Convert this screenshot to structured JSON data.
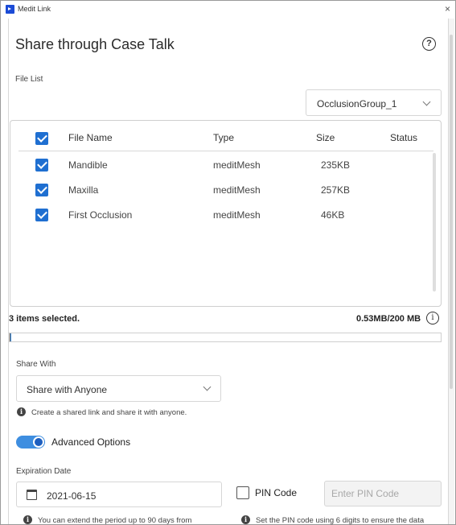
{
  "window": {
    "title": "Medit Link",
    "close_glyph": "×"
  },
  "page": {
    "title": "Share through Case Talk",
    "help_glyph": "?"
  },
  "file_list": {
    "label": "File List",
    "group_select": "OcclusionGroup_1",
    "columns": [
      "File Name",
      "Type",
      "Size",
      "Status"
    ],
    "rows": [
      {
        "name": "Mandible",
        "type": "meditMesh",
        "size": "235KB",
        "status": "",
        "checked": true
      },
      {
        "name": "Maxilla",
        "type": "meditMesh",
        "size": "257KB",
        "status": "",
        "checked": true
      },
      {
        "name": "First Occlusion",
        "type": "meditMesh",
        "size": "46KB",
        "status": "",
        "checked": true
      }
    ],
    "all_checked": true
  },
  "summary": {
    "selected_text": "3 items selected.",
    "size_text": "0.53MB/200 MB",
    "info_glyph": "i",
    "progress_fraction": 0.003
  },
  "share": {
    "label": "Share With",
    "value": "Share with Anyone",
    "hint": "Create a shared link and share it with anyone."
  },
  "advanced": {
    "label": "Advanced Options",
    "enabled": true
  },
  "expiration": {
    "label": "Expiration Date",
    "value": "2021-06-15",
    "hint": "You can extend the period up to 90 days from"
  },
  "pin": {
    "label": "PIN Code",
    "placeholder": "Enter PIN Code",
    "checked": false,
    "hint": "Set the PIN code using 6 digits to ensure the data"
  },
  "colors": {
    "accent": "#1f6fd1",
    "toggle_track": "#3e8ee0",
    "logo": "#1b4bd6"
  },
  "icons": {
    "logo": "medit-logo-icon",
    "help": "question-circle-icon",
    "info": "info-circle-icon",
    "hint": "info-filled-icon",
    "calendar": "calendar-icon",
    "chevron": "chevron-down-icon"
  }
}
